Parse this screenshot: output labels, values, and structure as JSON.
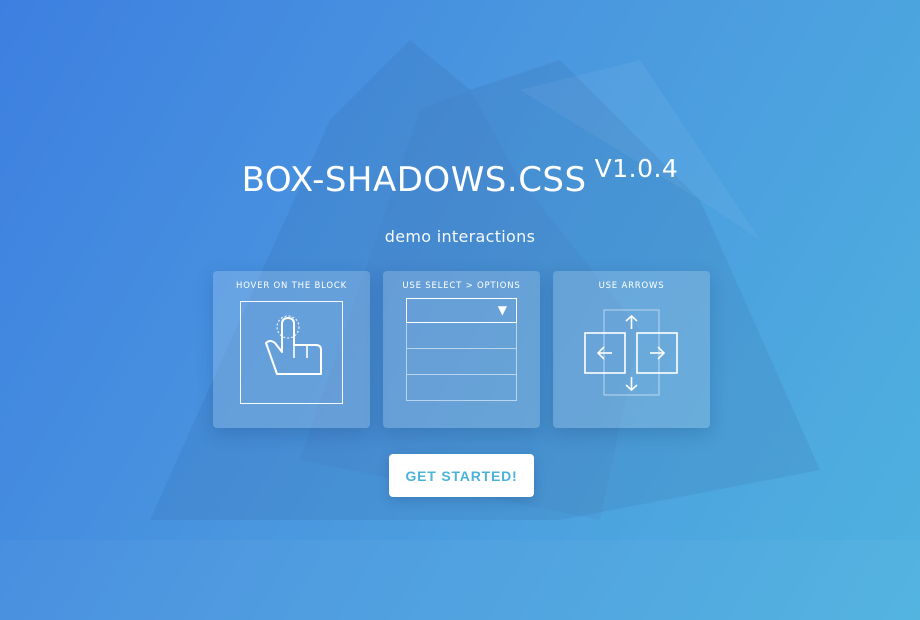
{
  "hero": {
    "title": "BOX-SHADOWS.CSS",
    "version": "V1.0.4",
    "subtitle": "demo interactions"
  },
  "cards": [
    {
      "label": "HOVER ON THE BLOCK",
      "icon": "hand-pointer-icon"
    },
    {
      "label": "USE SELECT > OPTIONS",
      "icon": "caret-down-icon",
      "option_count": 3
    },
    {
      "label": "USE ARROWS",
      "icons": [
        "arrow-up-icon",
        "arrow-left-icon",
        "arrow-right-icon",
        "arrow-down-icon"
      ]
    }
  ],
  "cta": {
    "label": "GET STARTED!"
  },
  "colors": {
    "gradient_start": "#3d7fe0",
    "gradient_end": "#4fb2df",
    "button_text": "#4cb3d8",
    "button_bg": "#ffffff"
  }
}
